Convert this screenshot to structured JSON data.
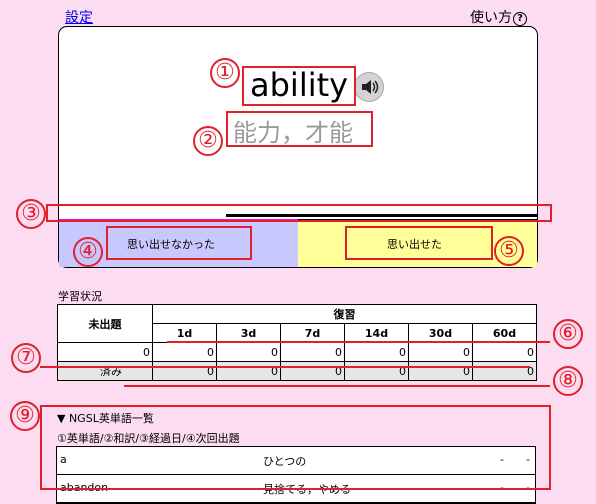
{
  "header": {
    "settings_label": "設定",
    "howto_label": "使い方",
    "howto_icon": "question-circle-icon",
    "howto_glyph": "?"
  },
  "card": {
    "word": "ability",
    "meaning": "能力，才能",
    "speaker_icon": "speaker-icon",
    "progress_fraction": 0.65,
    "buttons": {
      "forgot_label": "思い出せなかった",
      "remembered_label": "思い出せた"
    }
  },
  "annotations": [
    "①",
    "②",
    "③",
    "④",
    "⑤",
    "⑥",
    "⑦",
    "⑧",
    "⑨"
  ],
  "status": {
    "title": "学習状況",
    "headers": {
      "unasked": "未出題",
      "review": "復習",
      "intervals": [
        "1d",
        "3d",
        "7d",
        "14d",
        "30d",
        "60d"
      ]
    },
    "row_counts": {
      "unasked": "0",
      "values": [
        "0",
        "0",
        "0",
        "0",
        "0",
        "0"
      ]
    },
    "done_row": {
      "label": "済み",
      "values": [
        "0",
        "0",
        "0",
        "0",
        "0",
        "0"
      ]
    }
  },
  "word_list": {
    "title": "▼ NGSL英単語一覧",
    "subtitle": "①英単語/②和訳/③経過日/④次回出題",
    "rows": [
      {
        "word": "a",
        "meaning": "ひとつの",
        "elapsed": "-",
        "next": "-"
      },
      {
        "word": "abandon",
        "meaning": "見捨てる，やめる",
        "elapsed": "-",
        "next": "-"
      }
    ]
  },
  "colors": {
    "bg": "#fcdcf0",
    "annotation": "#e0202a",
    "forgot_bg": "#c8c8ff",
    "remembered_bg": "#ffff99",
    "link": "#0000ee"
  }
}
